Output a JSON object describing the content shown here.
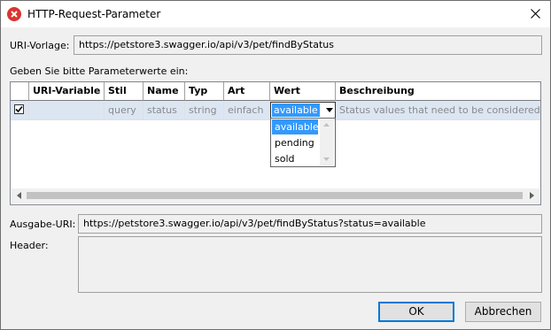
{
  "window": {
    "title": "HTTP-Request-Parameter"
  },
  "uri_template": {
    "label": "URI-Vorlage:",
    "value": "https://petstore3.swagger.io/api/v3/pet/findByStatus"
  },
  "param_prompt": "Geben Sie bitte Parameterwerte ein:",
  "table": {
    "columns": [
      "URI-Variable",
      "Stil",
      "Name",
      "Typ",
      "Art",
      "Wert",
      "Beschreibung"
    ],
    "rows": [
      {
        "checked": true,
        "uri_variable": "",
        "stil": "query",
        "name": "status",
        "typ": "string",
        "art": "einfach",
        "wert": "available",
        "beschreibung": "Status values that need to be considered for filter"
      }
    ],
    "wert_options": [
      "available",
      "pending",
      "sold"
    ],
    "wert_selected": "available"
  },
  "output_uri": {
    "label": "Ausgabe-URI:",
    "value": "https://petstore3.swagger.io/api/v3/pet/findByStatus?status=available"
  },
  "header": {
    "label": "Header:",
    "value": ""
  },
  "buttons": {
    "ok": "OK",
    "cancel": "Abbrechen"
  },
  "colors": {
    "selection": "#3399ff",
    "app_icon": "#d9362f",
    "default_button_border": "#0078d7"
  },
  "icons": {
    "app": "altova-app-icon",
    "close": "close-icon",
    "checkbox": "checkmark-icon",
    "dropdown": "chevron-down-icon"
  }
}
